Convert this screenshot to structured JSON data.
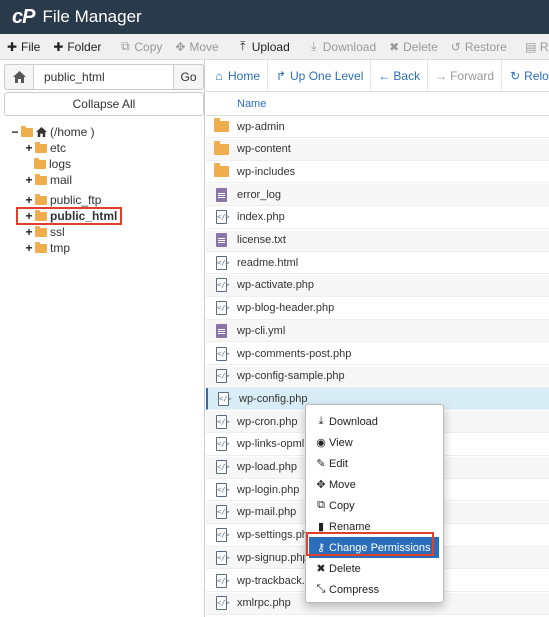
{
  "app": {
    "logo": "cP",
    "title": "File Manager"
  },
  "toolbar": [
    {
      "label": "File",
      "icon": "plus-icon",
      "glyph": "✚",
      "enabled": true
    },
    {
      "label": "Folder",
      "icon": "plus-icon",
      "glyph": "✚",
      "enabled": true
    },
    {
      "label": "Copy",
      "icon": "copy-icon",
      "glyph": "⧉",
      "enabled": false
    },
    {
      "label": "Move",
      "icon": "move-icon",
      "glyph": "✥",
      "enabled": false
    },
    {
      "label": "Upload",
      "icon": "upload-icon",
      "glyph": "⤒",
      "enabled": true
    },
    {
      "label": "Download",
      "icon": "download-icon",
      "glyph": "⤓",
      "enabled": false
    },
    {
      "label": "Delete",
      "icon": "delete-icon",
      "glyph": "✖",
      "enabled": false
    },
    {
      "label": "Restore",
      "icon": "restore-icon",
      "glyph": "↺",
      "enabled": false
    },
    {
      "label": "Rena",
      "icon": "rename-icon",
      "glyph": "▤",
      "enabled": false
    }
  ],
  "path_bar": {
    "home_icon": "home-icon",
    "value": "public_html",
    "go_label": "Go"
  },
  "collapse_label": "Collapse All",
  "tree": {
    "root": "(/home )",
    "items": [
      {
        "label": "etc",
        "toggle": "+"
      },
      {
        "label": "logs",
        "toggle": ""
      },
      {
        "label": "mail",
        "toggle": "+"
      },
      {
        "label": "public_ftp",
        "toggle": "+"
      },
      {
        "label": "public_html",
        "toggle": "+"
      },
      {
        "label": "ssl",
        "toggle": "+"
      },
      {
        "label": "tmp",
        "toggle": "+"
      }
    ],
    "selected": "public_html",
    "root_toggle": "−"
  },
  "nav": [
    {
      "label": "Home",
      "icon": "home-icon",
      "glyph": "⌂",
      "enabled": true
    },
    {
      "label": "Up One Level",
      "icon": "up-level-icon",
      "glyph": "↱",
      "enabled": true
    },
    {
      "label": "Back",
      "icon": "back-arrow-icon",
      "glyph": "←",
      "enabled": true
    },
    {
      "label": "Forward",
      "icon": "forward-arrow-icon",
      "glyph": "→",
      "enabled": false
    },
    {
      "label": "Reload",
      "icon": "reload-icon",
      "glyph": "↻",
      "enabled": true
    }
  ],
  "columns": {
    "name": "Name"
  },
  "files": [
    {
      "name": "wp-admin",
      "type": "folder"
    },
    {
      "name": "wp-content",
      "type": "folder"
    },
    {
      "name": "wp-includes",
      "type": "folder"
    },
    {
      "name": "error_log",
      "type": "doc"
    },
    {
      "name": "index.php",
      "type": "code"
    },
    {
      "name": "license.txt",
      "type": "doc"
    },
    {
      "name": "readme.html",
      "type": "code"
    },
    {
      "name": "wp-activate.php",
      "type": "code"
    },
    {
      "name": "wp-blog-header.php",
      "type": "code"
    },
    {
      "name": "wp-cli.yml",
      "type": "doc"
    },
    {
      "name": "wp-comments-post.php",
      "type": "code"
    },
    {
      "name": "wp-config-sample.php",
      "type": "code"
    },
    {
      "name": "wp-config.php",
      "type": "code"
    },
    {
      "name": "wp-cron.php",
      "type": "code"
    },
    {
      "name": "wp-links-opml.php",
      "type": "code"
    },
    {
      "name": "wp-load.php",
      "type": "code"
    },
    {
      "name": "wp-login.php",
      "type": "code"
    },
    {
      "name": "wp-mail.php",
      "type": "code"
    },
    {
      "name": "wp-settings.php",
      "type": "code"
    },
    {
      "name": "wp-signup.php",
      "type": "code"
    },
    {
      "name": "wp-trackback.php",
      "type": "code"
    },
    {
      "name": "xmlrpc.php",
      "type": "code"
    }
  ],
  "selected_file": "wp-config.php",
  "context_menu": [
    {
      "label": "Download",
      "icon": "download-icon",
      "glyph": "⤓"
    },
    {
      "label": "View",
      "icon": "eye-icon",
      "glyph": "◉"
    },
    {
      "label": "Edit",
      "icon": "pencil-icon",
      "glyph": "✎"
    },
    {
      "label": "Move",
      "icon": "move-icon",
      "glyph": "✥"
    },
    {
      "label": "Copy",
      "icon": "copy-icon",
      "glyph": "⧉"
    },
    {
      "label": "Rename",
      "icon": "file-icon",
      "glyph": "▮"
    },
    {
      "label": "Change Permissions",
      "icon": "key-icon",
      "glyph": "⚷"
    },
    {
      "label": "Delete",
      "icon": "delete-icon",
      "glyph": "✖"
    },
    {
      "label": "Compress",
      "icon": "compress-icon",
      "glyph": "⤡"
    }
  ],
  "highlighted_menu_item": "Change Permissions",
  "colors": {
    "titlebar": "#293a4a",
    "link": "#2a6ebb",
    "folder": "#f0ad4e",
    "highlight_border": "#e0402a"
  }
}
